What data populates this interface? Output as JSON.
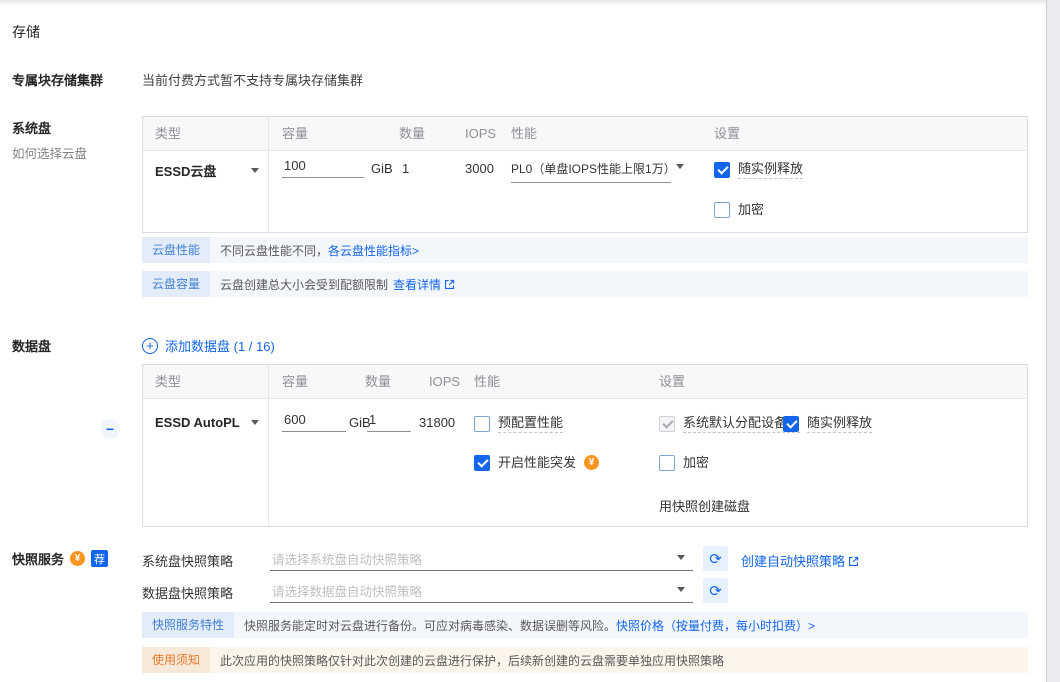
{
  "colors": {
    "accent": "#1366ec",
    "fee_orange": "#ff9420",
    "warn_text": "#e8782d",
    "note_bg_blue": "#f3f7fc",
    "note_bg_warn": "#fdf5ec"
  },
  "icons": {
    "plus": "+",
    "minus": "−",
    "refresh": "⟳",
    "fee": "¥",
    "caret": "caret-down",
    "external": "external-link"
  },
  "title": "存储",
  "dedicated": {
    "label": "专属块存储集群",
    "message": "当前付费方式暂不支持专属块存储集群"
  },
  "system_disk": {
    "label": "系统盘",
    "help": "如何选择云盘",
    "headers": {
      "type": "类型",
      "capacity": "容量",
      "quantity": "数量",
      "iops": "IOPS",
      "performance": "性能",
      "settings": "设置"
    },
    "row": {
      "type": "ESSD云盘",
      "capacity": "100",
      "unit": "GiB",
      "quantity": "1",
      "iops": "3000",
      "performance": "PL0（单盘IOPS性能上限1万）",
      "release_label": "随实例释放",
      "release_checked": true,
      "encrypt_label": "加密",
      "encrypt_checked": false
    },
    "note_perf": {
      "tag": "云盘性能",
      "text": "不同云盘性能不同，",
      "link": "各云盘性能指标>"
    },
    "note_quota": {
      "tag": "云盘容量",
      "text": "云盘创建总大小会受到配额限制",
      "link": "查看详情"
    }
  },
  "data_disk": {
    "label": "数据盘",
    "add_label": "添加数据盘 (1 / 16)",
    "headers": {
      "type": "类型",
      "capacity": "容量",
      "quantity": "数量",
      "iops": "IOPS",
      "performance": "性能",
      "settings": "设置"
    },
    "row": {
      "type": "ESSD AutoPL",
      "capacity": "600",
      "unit": "GiB",
      "quantity": "1",
      "iops": "31800",
      "provisioned_label": "预配置性能",
      "provisioned_checked": false,
      "burst_label": "开启性能突发",
      "burst_checked": true,
      "device_name_label": "系统默认分配设备名",
      "device_name_checked": true,
      "device_name_disabled": true,
      "release_label": "随实例释放",
      "release_checked": true,
      "encrypt_label": "加密",
      "encrypt_checked": false,
      "snapshot_link": "用快照创建磁盘"
    }
  },
  "snapshot": {
    "label": "快照服务",
    "badge": "荐",
    "system_policy": {
      "label": "系统盘快照策略",
      "placeholder": "请选择系统盘自动快照策略",
      "create_link": "创建自动快照策略"
    },
    "data_policy": {
      "label": "数据盘快照策略",
      "placeholder": "请选择数据盘自动快照策略"
    },
    "note_feature": {
      "tag": "快照服务特性",
      "text": "快照服务能定时对云盘进行备份。可应对病毒感染、数据误删等风险。",
      "link": "快照价格（按量付费，每小时扣费）>"
    },
    "note_notice": {
      "tag": "使用须知",
      "text": "此次应用的快照策略仅针对此次创建的云盘进行保护，后续新创建的云盘需要单独应用快照策略"
    }
  }
}
